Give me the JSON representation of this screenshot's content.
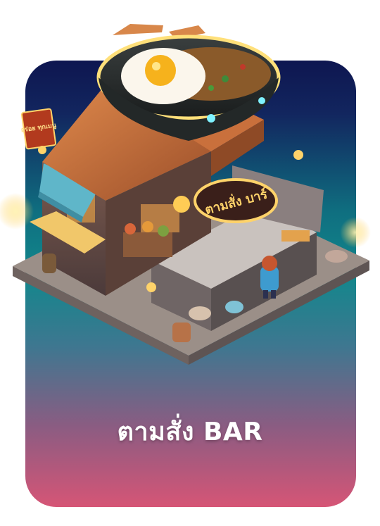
{
  "card": {
    "title": "ตามสั่ง BAR",
    "sign_text": "ตามสั่ง บาร์",
    "side_sign_text": "อร่อย ทุกเมนู"
  },
  "colors": {
    "top": "#0e1650",
    "middle": "#12878c",
    "bottom": "#d65576",
    "neon": "#ffd36a"
  }
}
